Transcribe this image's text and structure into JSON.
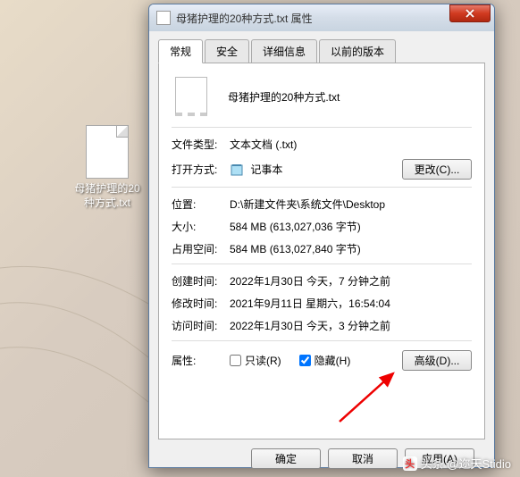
{
  "desktop": {
    "icon_label": "母猪护理的20种方式.txt"
  },
  "window": {
    "title": "母猪护理的20种方式.txt 属性"
  },
  "tabs": {
    "general": "常规",
    "security": "安全",
    "details": "详细信息",
    "previous": "以前的版本"
  },
  "filename": "母猪护理的20种方式.txt",
  "labels": {
    "file_type": "文件类型:",
    "open_with": "打开方式:",
    "location": "位置:",
    "size": "大小:",
    "size_on_disk": "占用空间:",
    "created": "创建时间:",
    "modified": "修改时间:",
    "accessed": "访问时间:",
    "attributes": "属性:"
  },
  "values": {
    "file_type": "文本文档 (.txt)",
    "open_with": "记事本",
    "location": "D:\\新建文件夹\\系统文件\\Desktop",
    "size": "584 MB (613,027,036 字节)",
    "size_on_disk": "584 MB (613,027,840 字节)",
    "created": "2022年1月30日 今天，7 分钟之前",
    "modified": "2021年9月11日 星期六，16:54:04",
    "accessed": "2022年1月30日 今天，3 分钟之前"
  },
  "buttons": {
    "change": "更改(C)...",
    "advanced": "高级(D)...",
    "ok": "确定",
    "cancel": "取消",
    "apply": "应用(A)"
  },
  "checkboxes": {
    "readonly": "只读(R)",
    "hidden": "隐藏(H)"
  },
  "watermark": "头条 @迩天Stidio"
}
